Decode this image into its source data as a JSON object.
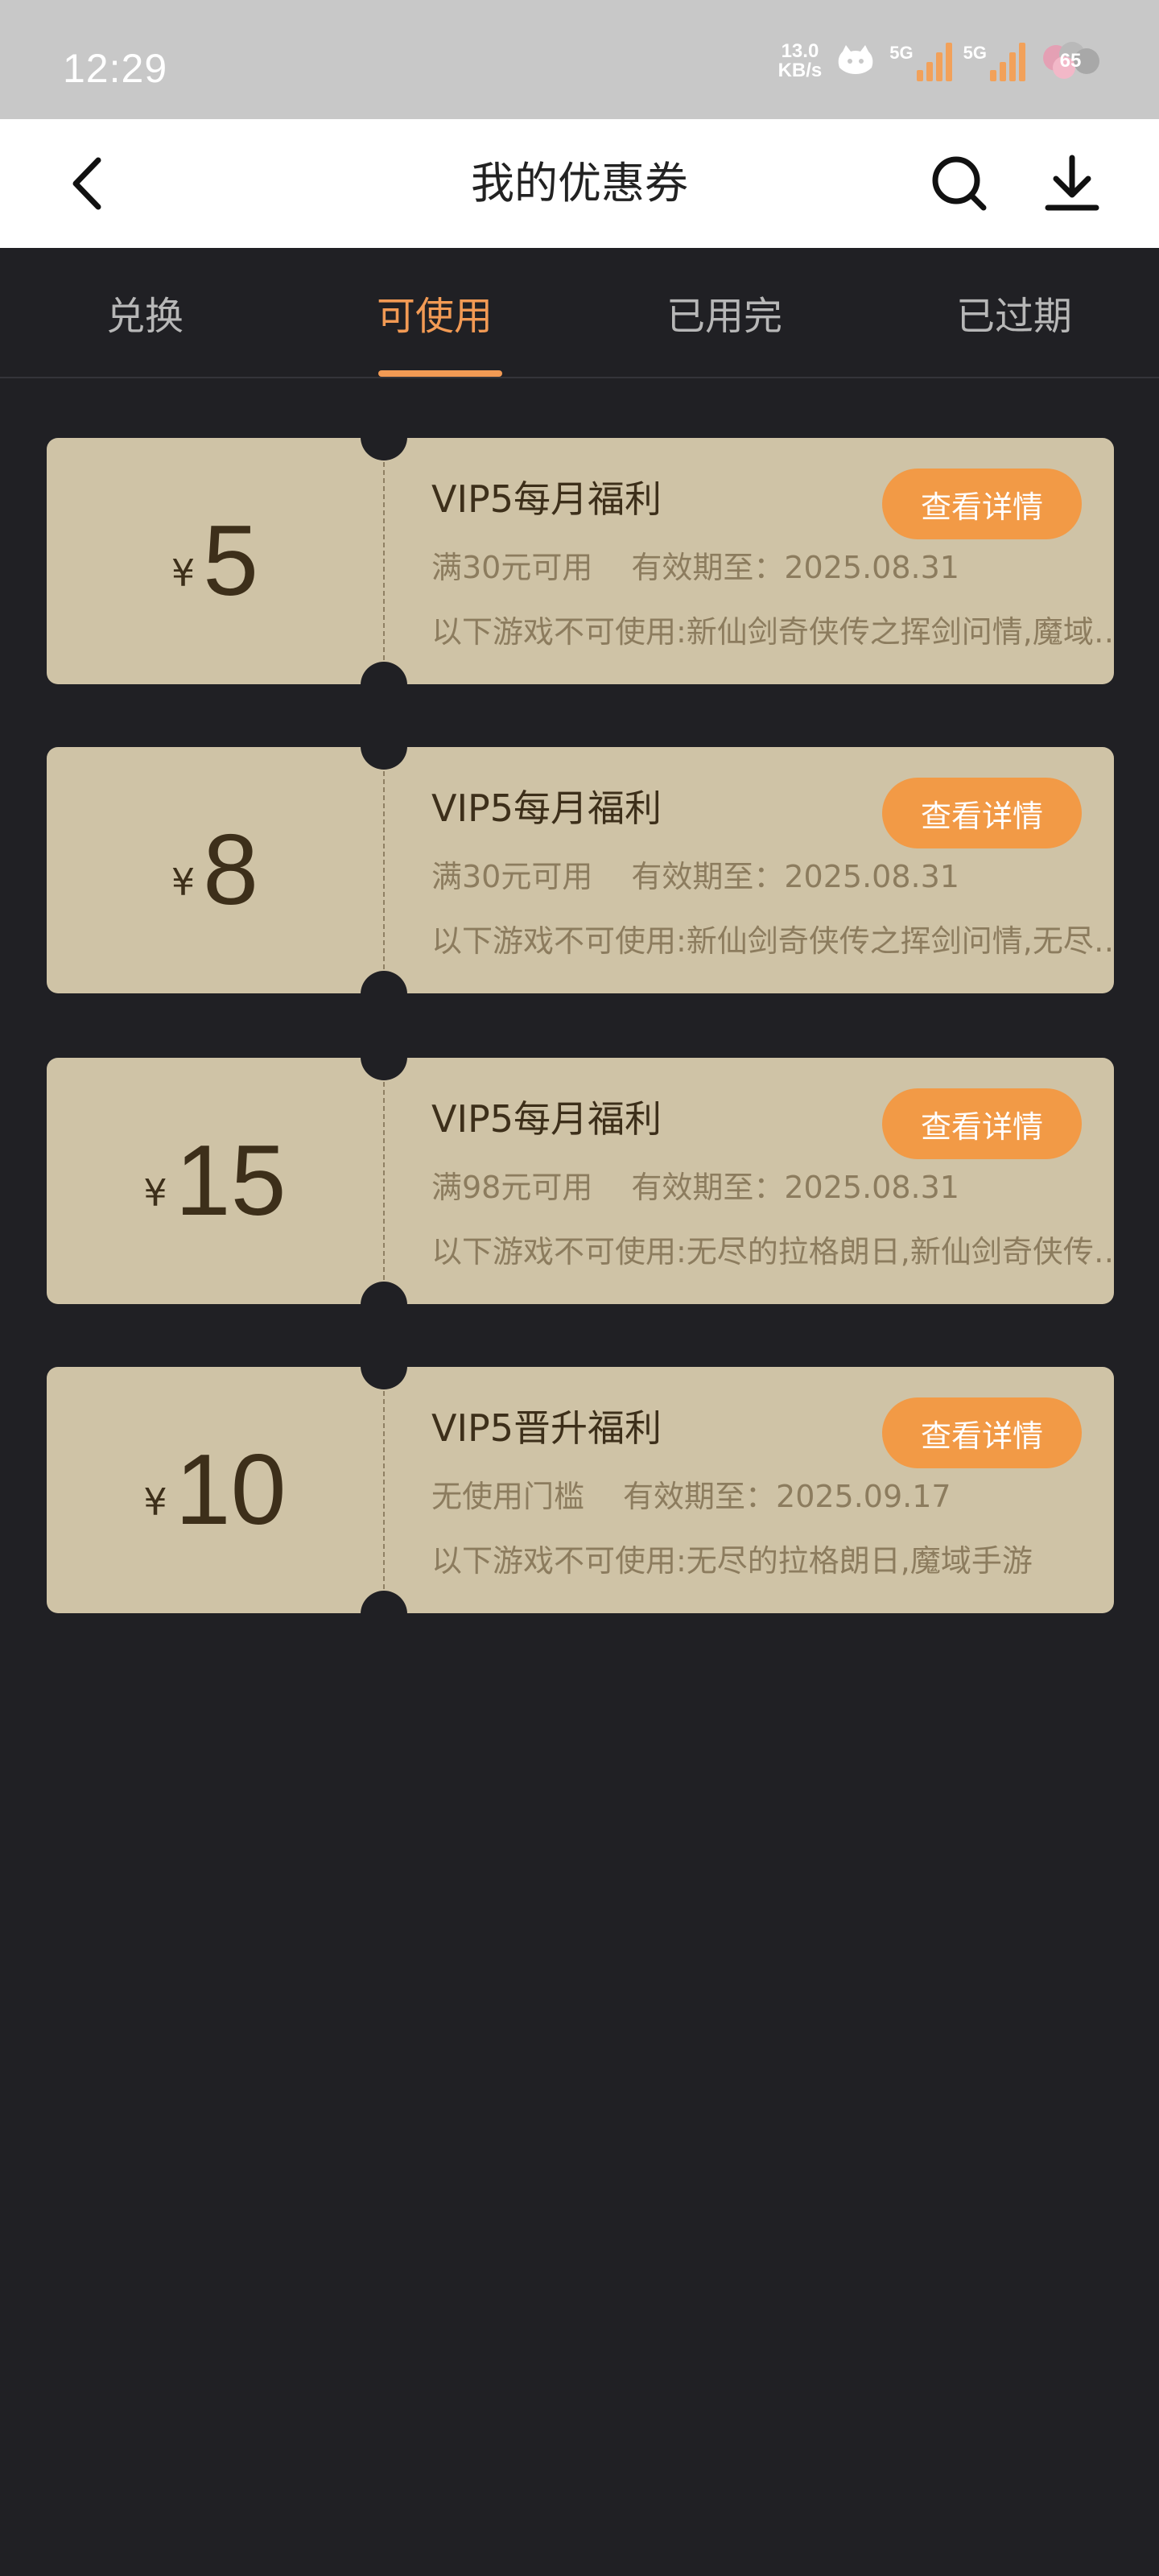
{
  "status_bar": {
    "time": "12:29",
    "net_speed_value": "13.0",
    "net_speed_unit": "KB/s",
    "sim1_label": "5G",
    "sim2_label": "5G",
    "battery": "65"
  },
  "header": {
    "title": "我的优惠券"
  },
  "tabs": [
    {
      "label": "兑换",
      "active": false
    },
    {
      "label": "可使用",
      "active": true
    },
    {
      "label": "已用完",
      "active": false
    },
    {
      "label": "已过期",
      "active": false
    }
  ],
  "coupons": [
    {
      "currency": "¥",
      "amount": "5",
      "title": "VIP5每月福利",
      "threshold": "满30元可用",
      "expiry": "有效期至：2025.08.31",
      "excluded": "以下游戏不可使用:新仙剑奇侠传之挥剑问情,魔域…",
      "button": "查看详情"
    },
    {
      "currency": "¥",
      "amount": "8",
      "title": "VIP5每月福利",
      "threshold": "满30元可用",
      "expiry": "有效期至：2025.08.31",
      "excluded": "以下游戏不可使用:新仙剑奇侠传之挥剑问情,无尽…",
      "button": "查看详情"
    },
    {
      "currency": "¥",
      "amount": "15",
      "title": "VIP5每月福利",
      "threshold": "满98元可用",
      "expiry": "有效期至：2025.08.31",
      "excluded": "以下游戏不可使用:无尽的拉格朗日,新仙剑奇侠传…",
      "button": "查看详情"
    },
    {
      "currency": "¥",
      "amount": "10",
      "title": "VIP5晋升福利",
      "threshold": "无使用门槛",
      "expiry": "有效期至：2025.09.17",
      "excluded": "以下游戏不可使用:无尽的拉格朗日,魔域手游",
      "button": "查看详情"
    }
  ],
  "icons": {
    "back": "chevron-left-icon",
    "search": "search-icon",
    "download": "download-icon"
  },
  "colors": {
    "accent": "#f29a46",
    "coupon_bg": "#cfc3a6",
    "page_bg": "#202024"
  }
}
